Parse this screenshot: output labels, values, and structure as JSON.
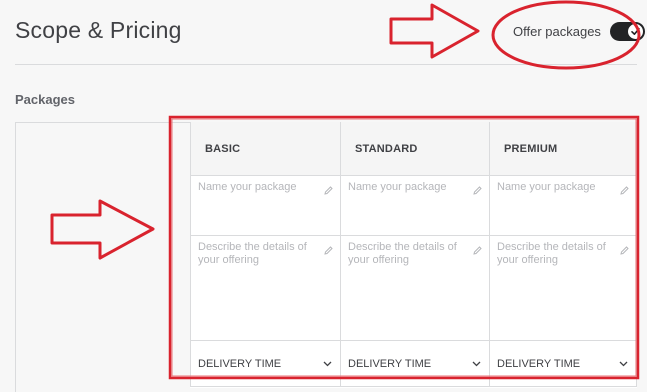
{
  "page": {
    "title": "Scope & Pricing"
  },
  "toggle": {
    "label": "Offer packages",
    "on": true
  },
  "section": {
    "label": "Packages"
  },
  "packages": [
    {
      "name": "BASIC",
      "name_placeholder": "Name your package",
      "desc_placeholder": "Describe the details of your offering",
      "delivery": "DELIVERY TIME"
    },
    {
      "name": "STANDARD",
      "name_placeholder": "Name your package",
      "desc_placeholder": "Describe the details of your offering",
      "delivery": "DELIVERY TIME"
    },
    {
      "name": "PREMIUM",
      "name_placeholder": "Name your package",
      "desc_placeholder": "Describe the details of your offering",
      "delivery": "DELIVERY TIME"
    }
  ],
  "icons": {
    "toggle": "check-icon",
    "edit": "pencil-icon",
    "dropdown": "chevron-down-icon"
  },
  "colors": {
    "annotation": "#d9232e",
    "toggle_on": "#222325",
    "text": "#404145",
    "placeholder": "#b5b6ba"
  }
}
